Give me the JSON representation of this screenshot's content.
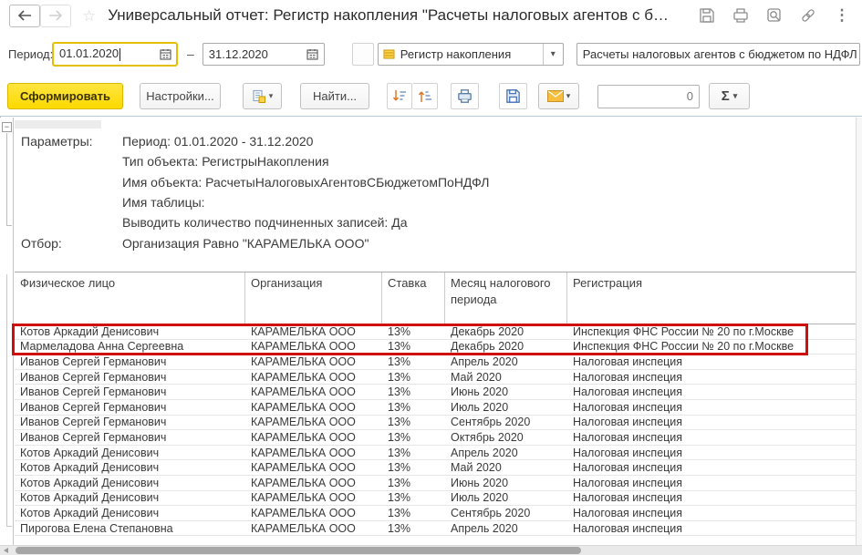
{
  "icons": {
    "star": "☆",
    "more_dots": "⋮",
    "caret_down": "▾",
    "expander_minus": "−",
    "sigma": "Σ"
  },
  "titlebar": {
    "title": "Универсальный отчет: Регистр накопления \"Расчеты налоговых агентов с б…"
  },
  "filterbar": {
    "period_label": "Период:",
    "date_from": "01.01.2020",
    "dash": "–",
    "date_to": "31.12.2020",
    "object_type": "Регистр накопления",
    "object_name": "Расчеты налоговых агентов с бюджетом по НДФЛ"
  },
  "toolbar": {
    "generate_label": "Сформировать",
    "settings_label": "Настройки...",
    "find_label": "Найти...",
    "counter_value": "0",
    "sigma_label": "Σ"
  },
  "colors": {
    "accent_yellow": "#fcd900",
    "highlight_red": "#cf0e0e"
  },
  "report": {
    "params": [
      {
        "label": "Параметры:",
        "value": "Период: 01.01.2020 - 31.12.2020"
      },
      {
        "label": "",
        "value": "Тип объекта: РегистрыНакопления"
      },
      {
        "label": "",
        "value": "Имя объекта: РасчетыНалоговыхАгентовСБюджетомПоНДФЛ"
      },
      {
        "label": "",
        "value": "Имя таблицы:"
      },
      {
        "label": "",
        "value": "Выводить количество подчиненных записей: Да"
      },
      {
        "label": "Отбор:",
        "value": "Организация Равно \"КАРАМЕЛЬКА ООО\""
      }
    ],
    "table": {
      "headers": [
        "Физическое лицо",
        "Организация",
        "Ставка",
        "Месяц налогового периода",
        "Регистрация"
      ],
      "highlight_row_count": 2,
      "rows": [
        [
          "Котов Аркадий Денисович",
          "КАРАМЕЛЬКА ООО",
          "13%",
          "Декабрь 2020",
          "Инспекция ФНС России № 20 по г.Москве"
        ],
        [
          "Мармеладова Анна Сергеевна",
          "КАРАМЕЛЬКА ООО",
          "13%",
          "Декабрь 2020",
          "Инспекция ФНС России № 20 по г.Москве"
        ],
        [
          "Иванов Сергей Германович",
          "КАРАМЕЛЬКА ООО",
          "13%",
          "Апрель 2020",
          "Налоговая инспеция"
        ],
        [
          "Иванов Сергей Германович",
          "КАРАМЕЛЬКА ООО",
          "13%",
          "Май 2020",
          "Налоговая инспеция"
        ],
        [
          "Иванов Сергей Германович",
          "КАРАМЕЛЬКА ООО",
          "13%",
          "Июнь 2020",
          "Налоговая инспеция"
        ],
        [
          "Иванов Сергей Германович",
          "КАРАМЕЛЬКА ООО",
          "13%",
          "Июль 2020",
          "Налоговая инспеция"
        ],
        [
          "Иванов Сергей Германович",
          "КАРАМЕЛЬКА ООО",
          "13%",
          "Сентябрь 2020",
          "Налоговая инспеция"
        ],
        [
          "Иванов Сергей Германович",
          "КАРАМЕЛЬКА ООО",
          "13%",
          "Октябрь 2020",
          "Налоговая инспеция"
        ],
        [
          "Котов Аркадий Денисович",
          "КАРАМЕЛЬКА ООО",
          "13%",
          "Апрель 2020",
          "Налоговая инспеция"
        ],
        [
          "Котов Аркадий Денисович",
          "КАРАМЕЛЬКА ООО",
          "13%",
          "Май 2020",
          "Налоговая инспеция"
        ],
        [
          "Котов Аркадий Денисович",
          "КАРАМЕЛЬКА ООО",
          "13%",
          "Июнь 2020",
          "Налоговая инспеция"
        ],
        [
          "Котов Аркадий Денисович",
          "КАРАМЕЛЬКА ООО",
          "13%",
          "Июль 2020",
          "Налоговая инспеция"
        ],
        [
          "Котов Аркадий Денисович",
          "КАРАМЕЛЬКА ООО",
          "13%",
          "Сентябрь 2020",
          "Налоговая инспеция"
        ],
        [
          "Пирогова Елена Степановна",
          "КАРАМЕЛЬКА ООО",
          "13%",
          "Апрель 2020",
          "Налоговая инспеция"
        ]
      ]
    }
  }
}
